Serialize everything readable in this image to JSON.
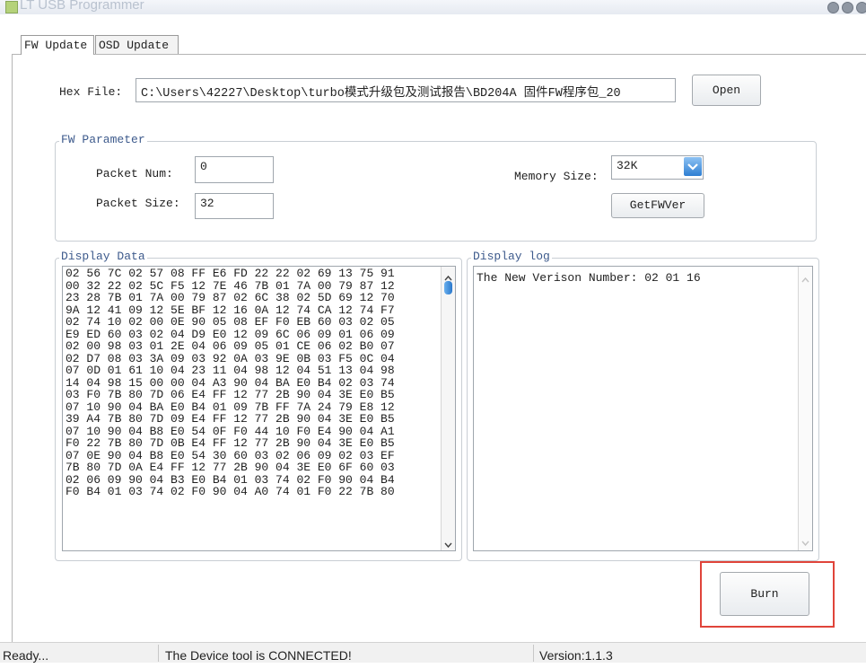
{
  "window": {
    "title": "LT USB Programmer"
  },
  "tabs": [
    {
      "label": "FW Update",
      "active": true
    },
    {
      "label": "OSD Update",
      "active": false
    }
  ],
  "hex_file": {
    "label": "Hex File:",
    "value": "C:\\Users\\42227\\Desktop\\turbo模式升级包及测试报告\\BD204A 固件FW程序包_20",
    "open_label": "Open"
  },
  "fw_parameter": {
    "title": "FW Parameter",
    "packet_num_label": "Packet Num:",
    "packet_num_value": "0",
    "packet_size_label": "Packet Size:",
    "packet_size_value": "32",
    "memory_size_label": "Memory Size:",
    "memory_size_value": "32K",
    "getfwver_label": "GetFWVer"
  },
  "display_data": {
    "title": "Display Data",
    "lines": [
      "02 56 7C 02 57 08 FF E6 FD 22 22 02 69 13 75 91",
      "00 32 22 02 5C F5 12 7E 46 7B 01 7A 00 79 87 12",
      "23 28 7B 01 7A 00 79 87 02 6C 38 02 5D 69 12 70",
      "9A 12 41 09 12 5E BF 12 16 0A 12 74 CA 12 74 F7",
      "02 74 10 02 00 0E 90 05 08 EF F0 EB 60 03 02 05",
      "E9 ED 60 03 02 04 D9 E0 12 09 6C 06 09 01 06 09",
      "02 00 98 03 01 2E 04 06 09 05 01 CE 06 02 B0 07",
      "02 D7 08 03 3A 09 03 92 0A 03 9E 0B 03 F5 0C 04",
      "07 0D 01 61 10 04 23 11 04 98 12 04 51 13 04 98",
      "14 04 98 15 00 00 04 A3 90 04 BA E0 B4 02 03 74",
      "03 F0 7B 80 7D 06 E4 FF 12 77 2B 90 04 3E E0 B5",
      "07 10 90 04 BA E0 B4 01 09 7B FF 7A 24 79 E8 12",
      "39 A4 7B 80 7D 09 E4 FF 12 77 2B 90 04 3E E0 B5",
      "07 10 90 04 B8 E0 54 0F F0 44 10 F0 E4 90 04 A1",
      "F0 22 7B 80 7D 0B E4 FF 12 77 2B 90 04 3E E0 B5",
      "07 0E 90 04 B8 E0 54 30 60 03 02 06 09 02 03 EF",
      "7B 80 7D 0A E4 FF 12 77 2B 90 04 3E E0 6F 60 03",
      "02 06 09 90 04 B3 E0 B4 01 03 74 02 F0 90 04 B4",
      "F0 B4 01 03 74 02 F0 90 04 A0 74 01 F0 22 7B 80"
    ]
  },
  "display_log": {
    "title": "Display log",
    "text": "The New Verison Number: 02 01 16"
  },
  "burn_label": "Burn",
  "highlight_color": "#e0443a",
  "status": {
    "ready": "Ready...",
    "device": "The Device tool is CONNECTED!",
    "version": "Version:1.1.3"
  }
}
